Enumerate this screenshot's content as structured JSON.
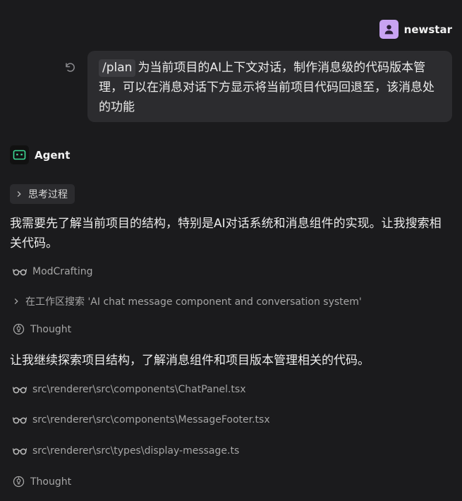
{
  "user": {
    "name": "newstar",
    "message": {
      "command": "/plan",
      "text": "为当前项目的AI上下文对话，制作消息级的代码版本管理，可以在消息对话下方显示将当前项目代码回退至，该消息处的功能"
    }
  },
  "agent": {
    "name": "Agent",
    "thinking_label": "思考过程",
    "paragraph_1": "我需要先了解当前项目的结构，特别是AI对话系统和消息组件的实现。让我搜索相关代码。",
    "tool_1": "ModCrafting",
    "search_row": "在工作区搜索 'AI chat message component and conversation system'",
    "thought_1": "Thought",
    "paragraph_2": "让我继续探索项目结构，了解消息组件和项目版本管理相关的代码。",
    "file_1": "src\\renderer\\src\\components\\ChatPanel.tsx",
    "file_2": "src\\renderer\\src\\components\\MessageFooter.tsx",
    "file_3": "src\\renderer\\src\\types\\display-message.ts",
    "thought_2": "Thought"
  },
  "colors": {
    "user_avatar": "#c9a3f2",
    "agent_icon": "#3ddc97",
    "bubble": "#2c2c2f",
    "background": "#1b1b1d"
  },
  "icons": {
    "user_avatar": "person-icon",
    "undo": "undo-icon",
    "agent_avatar": "robot-icon",
    "tool": "glasses-icon",
    "thought": "lightbulb-icon",
    "expand": "chevron-right-icon"
  }
}
